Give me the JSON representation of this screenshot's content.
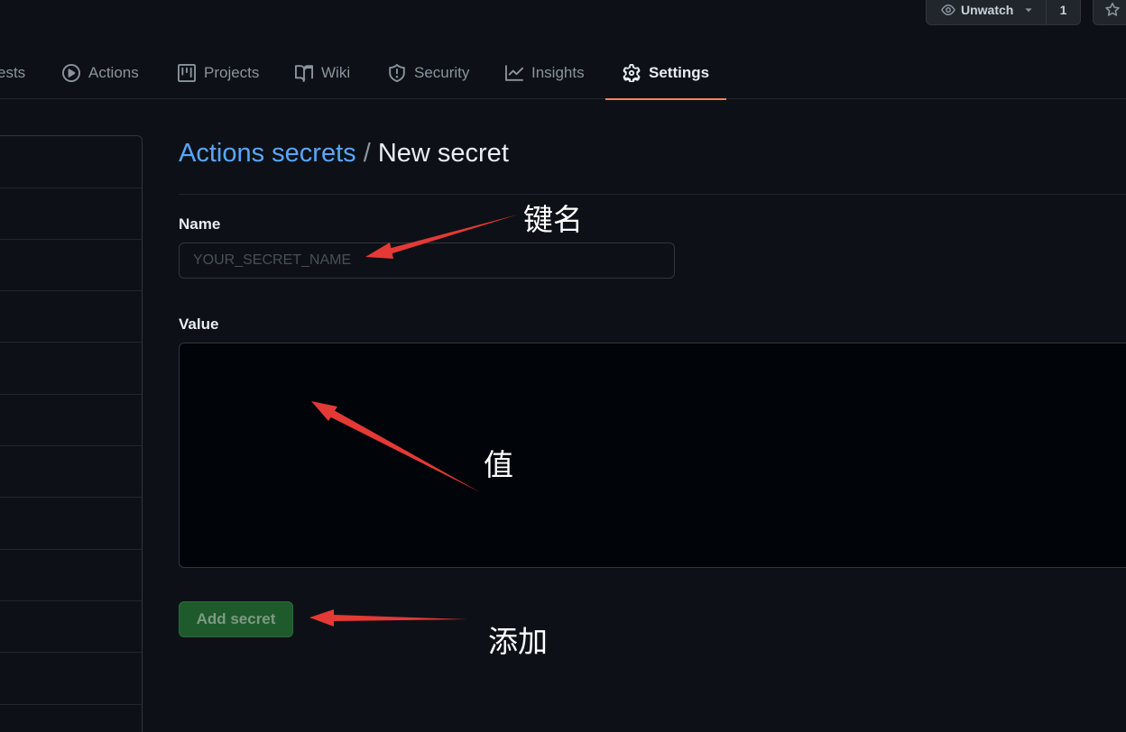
{
  "repo_actions": {
    "unwatch_label": "Unwatch",
    "watch_count": "1"
  },
  "tabs": [
    {
      "label": "ests",
      "icon": "pull-request-icon"
    },
    {
      "label": "Actions",
      "icon": "play-icon"
    },
    {
      "label": "Projects",
      "icon": "project-icon"
    },
    {
      "label": "Wiki",
      "icon": "book-icon"
    },
    {
      "label": "Security",
      "icon": "shield-icon"
    },
    {
      "label": "Insights",
      "icon": "graph-icon"
    },
    {
      "label": "Settings",
      "icon": "gear-icon",
      "selected": true
    }
  ],
  "page": {
    "breadcrumb_link": "Actions secrets",
    "separator": "/",
    "current": "New secret"
  },
  "form": {
    "name_label": "Name",
    "name_placeholder": "YOUR_SECRET_NAME",
    "name_value": "",
    "value_label": "Value",
    "value_value": "",
    "submit_label": "Add secret"
  },
  "annotations": {
    "name_note": "键名",
    "value_note": "值",
    "submit_note": "添加"
  },
  "colors": {
    "background": "#0d1117",
    "link": "#58a6ff",
    "selected_tab_underline": "#f78166",
    "submit_button": "#1f5a2c",
    "annotation_arrow": "#e53935"
  }
}
